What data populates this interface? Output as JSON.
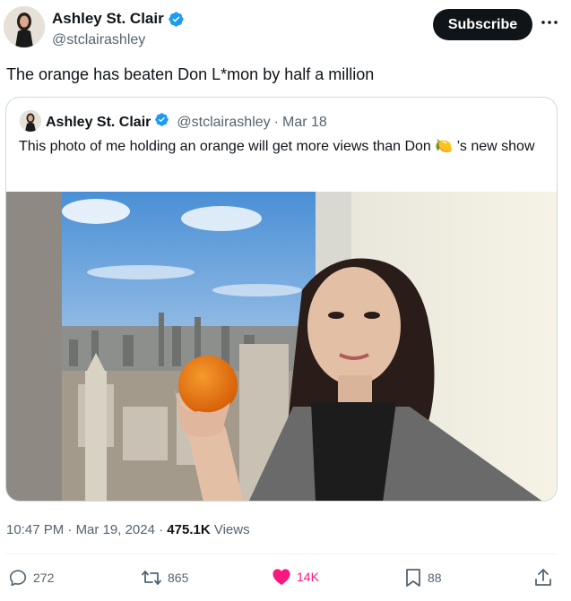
{
  "author": {
    "name": "Ashley St. Clair",
    "handle": "@stclairashley",
    "verified": true
  },
  "subscribe_label": "Subscribe",
  "more_icon": "more-horizontal-icon",
  "tweet_text": "The orange has beaten Don L*mon by half a million",
  "quoted": {
    "name": "Ashley St. Clair",
    "handle": "@stclairashley",
    "separator": "·",
    "date": "Mar 18",
    "text_before": "This photo of me holding an orange will get more views than Don",
    "emoji": "🍋",
    "text_after": "’s new show",
    "image_alt": "Woman holding an orange in front of a high-rise window with a city skyline"
  },
  "meta": {
    "time": "10:47 PM",
    "sep1": "·",
    "date": "Mar 19, 2024",
    "sep2": "·",
    "views_count": "475.1K",
    "views_label": "Views"
  },
  "actions": {
    "replies": "272",
    "reposts": "865",
    "likes": "14K",
    "bookmarks": "88"
  },
  "colors": {
    "verified_blue": "#1d9bf0",
    "like_pink": "#f91880",
    "secondary_text": "#536471",
    "border": "#cfd9de"
  }
}
